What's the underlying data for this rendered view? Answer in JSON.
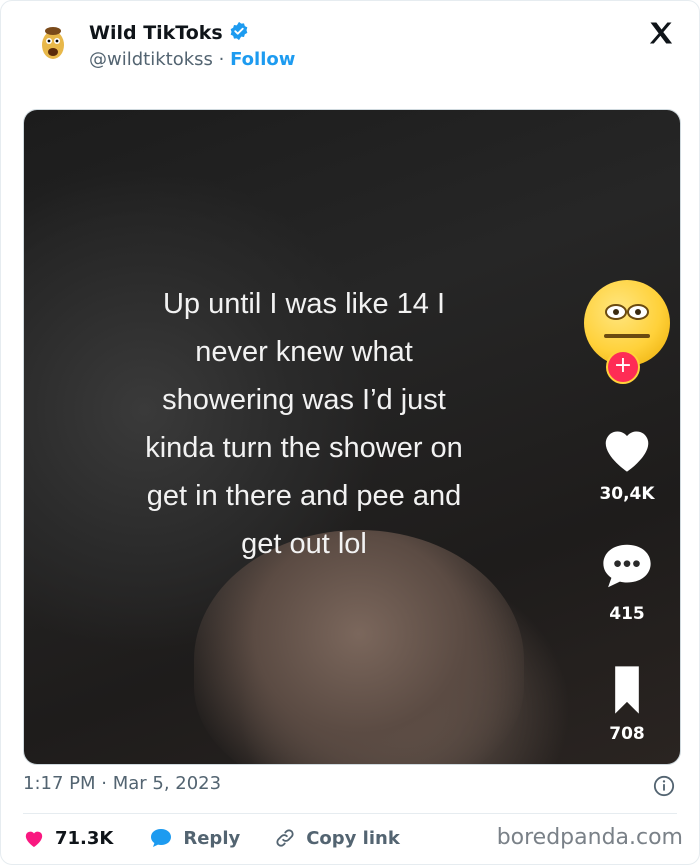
{
  "header": {
    "name": "Wild TikToks",
    "handle": "@wildtiktokss",
    "separator": "·",
    "follow_label": "Follow"
  },
  "media": {
    "caption_lines": [
      "Up until I was like 14 I",
      "never knew what",
      "showering was I’d just",
      "kinda turn the shower on",
      "get in there and pee and",
      "get out lol"
    ],
    "likes": "30,4K",
    "comments": "415",
    "saves": "708",
    "plus": "+"
  },
  "footer": {
    "timestamp": "1:17 PM · Mar 5, 2023",
    "like_count": "71.3K",
    "reply_label": "Reply",
    "copy_label": "Copy link",
    "watermark": "boredpanda.com"
  },
  "colors": {
    "follow": "#1d9bf0",
    "like_heart": "#f91880",
    "plus_badge": "#fe2c55"
  },
  "icons": [
    "avatar-icon",
    "verified-badge-icon",
    "x-logo-icon",
    "heart-icon",
    "comment-icon",
    "bookmark-icon",
    "info-icon",
    "reply-icon",
    "link-icon"
  ]
}
